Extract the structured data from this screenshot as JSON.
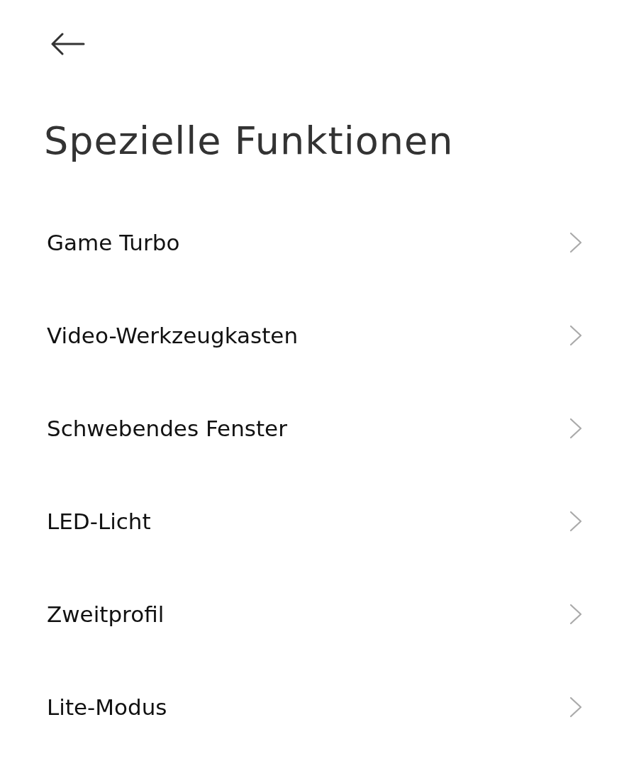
{
  "title": "Spezielle Funktionen",
  "items": [
    {
      "label": "Game Turbo"
    },
    {
      "label": "Video-Werkzeugkasten"
    },
    {
      "label": "Schwebendes Fenster"
    },
    {
      "label": "LED-Licht"
    },
    {
      "label": "Zweitprofil"
    },
    {
      "label": "Lite-Modus"
    }
  ]
}
